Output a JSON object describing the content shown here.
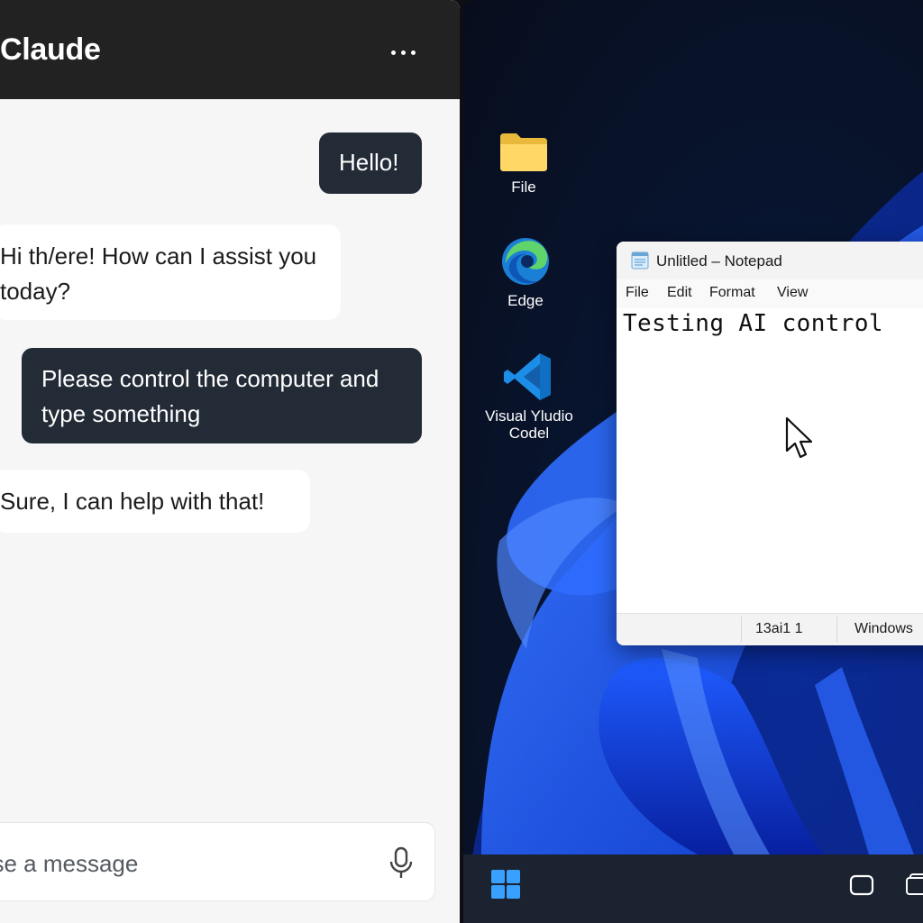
{
  "chat": {
    "title": "Claude",
    "messages": [
      {
        "role": "user",
        "text": "Hello!"
      },
      {
        "role": "assistant",
        "text": "Hi th/ere! How can I assist you today?"
      },
      {
        "role": "user",
        "text": "Please control the computer and type something"
      },
      {
        "role": "assistant",
        "text": "Sure, I can help with that!"
      }
    ],
    "composer": {
      "placeholder": "ase a message"
    }
  },
  "desktop": {
    "icons": [
      {
        "label": "File",
        "icon": "folder-icon"
      },
      {
        "label": "Edge",
        "icon": "edge-icon"
      },
      {
        "label": "Visual Yludio Codel",
        "icon": "vscode-icon"
      }
    ]
  },
  "notepad": {
    "title": "Unlitled – Notepad",
    "menu": [
      "File",
      "Edit",
      "Format",
      "View"
    ],
    "content": "Testing AI control",
    "status": {
      "position": "13ai1 1",
      "encoding": "Windows"
    }
  },
  "taskbar": {
    "icons": [
      "windows-start-icon",
      "task-view-icon",
      "tray-icon"
    ]
  },
  "colors": {
    "header_bg": "#222222",
    "user_bubble": "#222b36",
    "assistant_bubble": "#ffffff",
    "wallpaper_accent": "#1a5cff"
  }
}
